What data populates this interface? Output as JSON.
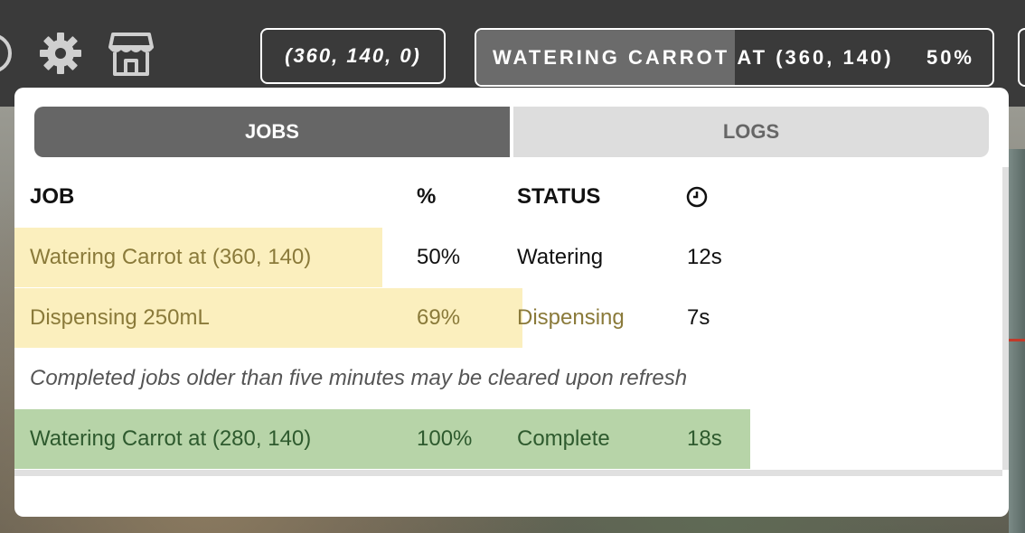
{
  "navbar": {
    "coords": "(360, 140, 0)",
    "current_job": {
      "label": "WATERING CARROT AT (360, 140)",
      "percent_label": "50%",
      "progress": 0.5
    },
    "icons": [
      "power-icon",
      "gear-icon",
      "shop-icon"
    ]
  },
  "panel": {
    "tabs": [
      {
        "label": "JOBS",
        "active": true
      },
      {
        "label": "LOGS",
        "active": false
      }
    ],
    "columns": [
      "JOB",
      "%",
      "STATUS"
    ],
    "clock_icon": "clock-icon",
    "jobs": [
      {
        "job": "Watering Carrot at (360, 140)",
        "percent": "50%",
        "status": "Watering",
        "time": "12s",
        "progress": 0.5,
        "color": "#fbefbe",
        "text_color": "#8a7a3a"
      },
      {
        "job": "Dispensing 250mL",
        "percent": "69%",
        "status": "Dispensing",
        "time": "7s",
        "progress": 0.69,
        "color": "#fbefbe",
        "text_color": "#8a7a3a"
      }
    ],
    "note": "Completed jobs older than five minutes may be cleared upon refresh",
    "completed_jobs": [
      {
        "job": "Watering Carrot at (280, 140)",
        "percent": "100%",
        "status": "Complete",
        "time": "18s",
        "progress": 1.0,
        "color": "#b7d4a8",
        "text_color": "#2e5a2e"
      }
    ]
  },
  "colors": {
    "navbar": "#3a3a3a",
    "tab_active": "#666666",
    "tab_inactive": "#dddddd",
    "in_progress": "#fbefbe",
    "complete": "#b7d4a8"
  }
}
